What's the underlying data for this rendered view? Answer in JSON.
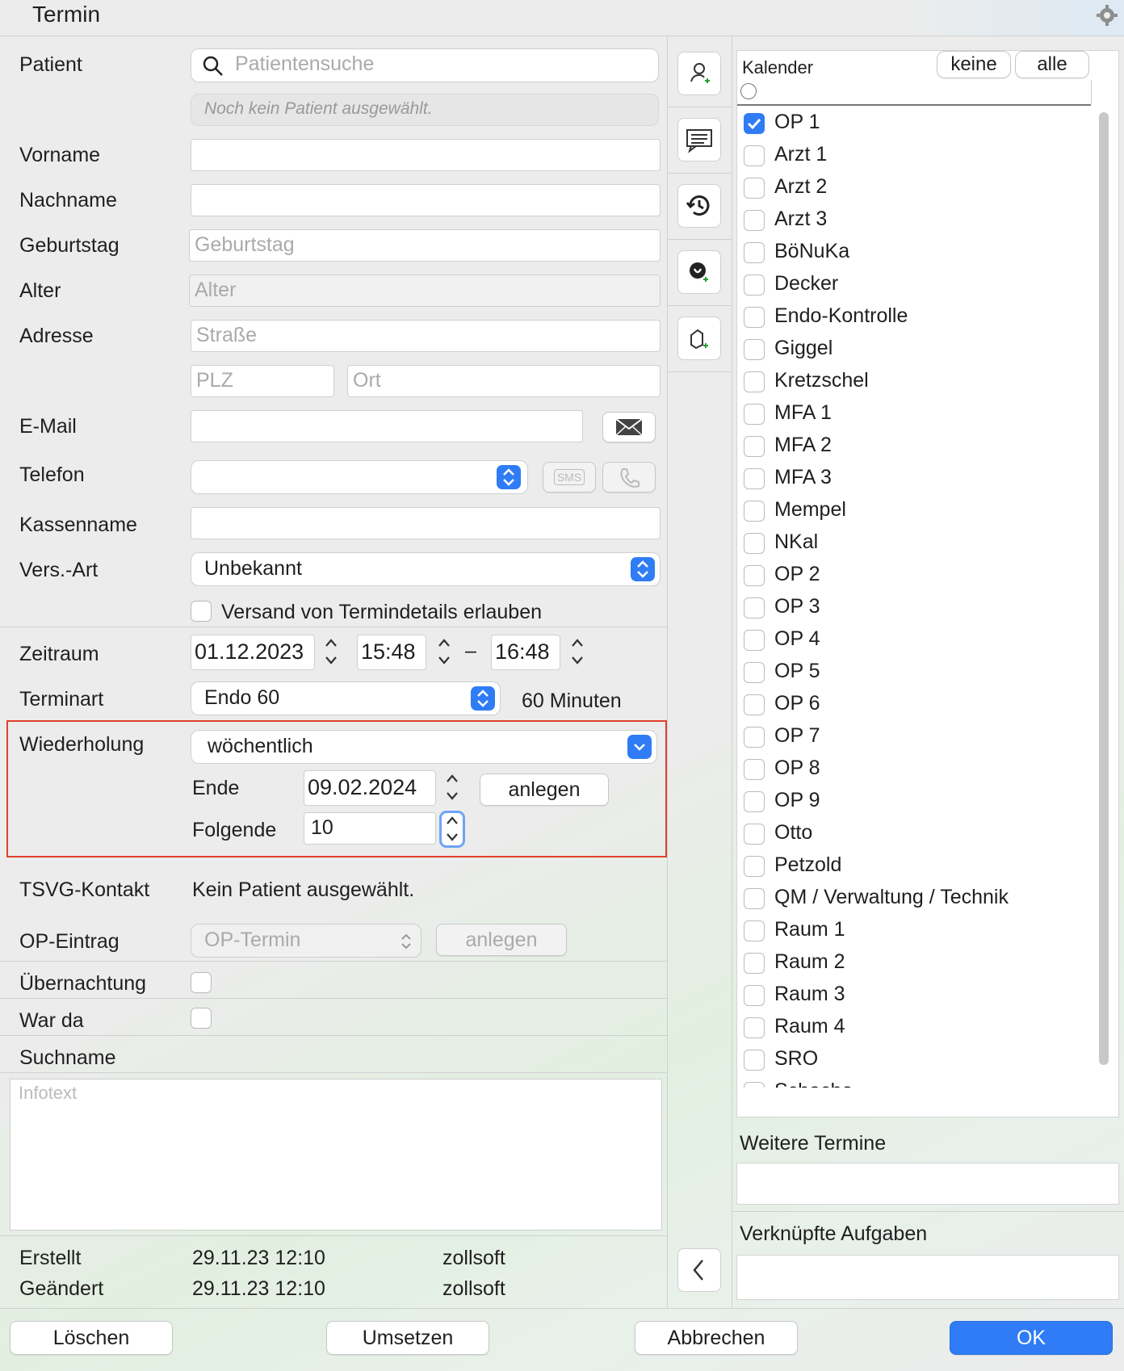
{
  "window": {
    "title": "Termin"
  },
  "form": {
    "patient_label": "Patient",
    "patient_search_placeholder": "Patientensuche",
    "patient_status": "Noch kein Patient ausgewählt.",
    "vorname_label": "Vorname",
    "nachname_label": "Nachname",
    "geburtstag_label": "Geburtstag",
    "geburtstag_placeholder": "Geburtstag",
    "alter_label": "Alter",
    "alter_placeholder": "Alter",
    "adresse_label": "Adresse",
    "strasse_placeholder": "Straße",
    "plz_placeholder": "PLZ",
    "ort_placeholder": "Ort",
    "email_label": "E-Mail",
    "telefon_label": "Telefon",
    "sms_label": "SMS",
    "kassenname_label": "Kassenname",
    "versart_label": "Vers.-Art",
    "versart_value": "Unbekannt",
    "versand_label": "Versand von Termindetails erlauben",
    "zeitraum_label": "Zeitraum",
    "date_value": "01.12.2023",
    "start_time": "15:48",
    "dash": "–",
    "end_time": "16:48",
    "terminart_label": "Terminart",
    "terminart_value": "Endo 60",
    "duration": "60 Minuten",
    "wiederholung_label": "Wiederholung",
    "wiederholung_value": "wöchentlich",
    "ende_label": "Ende",
    "ende_value": "09.02.2024",
    "anlegen_label": "anlegen",
    "folgende_label": "Folgende",
    "folgende_value": "10",
    "tsvg_label": "TSVG-Kontakt",
    "tsvg_value": "Kein Patient ausgewählt.",
    "op_label": "OP-Eintrag",
    "op_value": "OP-Termin",
    "op_anlegen": "anlegen",
    "uebernachtung_label": "Übernachtung",
    "warda_label": "War da",
    "suchname_label": "Suchname",
    "infotext_placeholder": "Infotext",
    "erstellt_label": "Erstellt",
    "erstellt_date": "29.11.23 12:10",
    "erstellt_user": "zollsoft",
    "geaendert_label": "Geändert",
    "geaendert_date": "29.11.23 12:10",
    "geaendert_user": "zollsoft"
  },
  "calendar": {
    "label": "Kalender",
    "keine": "keine",
    "alle": "alle",
    "items": [
      {
        "name": "OP 1",
        "checked": true
      },
      {
        "name": "Arzt 1",
        "checked": false
      },
      {
        "name": "Arzt 2",
        "checked": false
      },
      {
        "name": "Arzt 3",
        "checked": false
      },
      {
        "name": "BöNuKa",
        "checked": false
      },
      {
        "name": "Decker",
        "checked": false
      },
      {
        "name": "Endo-Kontrolle",
        "checked": false
      },
      {
        "name": "Giggel",
        "checked": false
      },
      {
        "name": "Kretzschel",
        "checked": false
      },
      {
        "name": "MFA 1",
        "checked": false
      },
      {
        "name": "MFA 2",
        "checked": false
      },
      {
        "name": "MFA 3",
        "checked": false
      },
      {
        "name": "Mempel",
        "checked": false
      },
      {
        "name": "NKal",
        "checked": false
      },
      {
        "name": "OP 2",
        "checked": false
      },
      {
        "name": "OP 3",
        "checked": false
      },
      {
        "name": "OP 4",
        "checked": false
      },
      {
        "name": "OP 5",
        "checked": false
      },
      {
        "name": "OP 6",
        "checked": false
      },
      {
        "name": "OP 7",
        "checked": false
      },
      {
        "name": "OP 8",
        "checked": false
      },
      {
        "name": "OP 9",
        "checked": false
      },
      {
        "name": "Otto",
        "checked": false
      },
      {
        "name": "Petzold",
        "checked": false
      },
      {
        "name": "QM / Verwaltung / Technik",
        "checked": false
      },
      {
        "name": "Raum 1",
        "checked": false
      },
      {
        "name": "Raum 2",
        "checked": false
      },
      {
        "name": "Raum 3",
        "checked": false
      },
      {
        "name": "Raum 4",
        "checked": false
      },
      {
        "name": "SRO",
        "checked": false
      },
      {
        "name": "Schache",
        "checked": false
      }
    ],
    "weitere_label": "Weitere Termine",
    "aufgaben_label": "Verknüpfte Aufgaben"
  },
  "footer": {
    "loeschen": "Löschen",
    "umsetzen": "Umsetzen",
    "abbrechen": "Abbrechen",
    "ok": "OK"
  },
  "colors": {
    "accent": "#2f7cf6",
    "highlight_border": "#e0402a",
    "check": "#2f7cf6"
  }
}
